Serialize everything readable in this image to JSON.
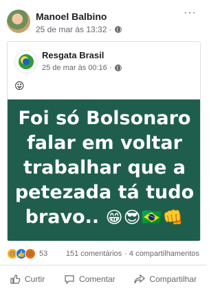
{
  "post": {
    "author": "Manoel Balbino",
    "time": "25 de mar às 13:32 ·",
    "more": "···"
  },
  "shared": {
    "page_name": "Resgata Brasil",
    "time": "25 de mar às 00:16 ·",
    "emoji": "😜",
    "banner_text": "Foi só Bolsonaro falar em voltar trabalhar que a petezada tá tudo bravo..",
    "banner_emojis": "😁😎🇧🇷👊"
  },
  "stats": {
    "reactions_count": "53",
    "comments": "151 comentários",
    "shares": "· 4 compartilhamentos"
  },
  "actions": {
    "like": "Curtir",
    "comment": "Comentar",
    "share": "Compartilhar"
  },
  "colors": {
    "banner_bg": "#1f5e4c",
    "text_primary": "#1c1e21",
    "text_secondary": "#65676b"
  }
}
